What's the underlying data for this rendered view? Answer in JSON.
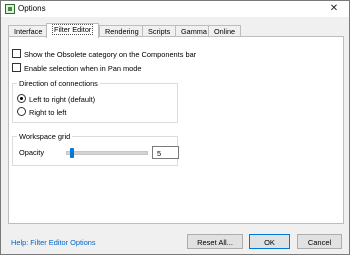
{
  "window": {
    "title": "Options",
    "close_glyph": "✕"
  },
  "tabs": [
    {
      "label": "Interface"
    },
    {
      "label": "Filter Editor"
    },
    {
      "label": "Rendering"
    },
    {
      "label": "Scripts"
    },
    {
      "label": "Gamma"
    },
    {
      "label": "Online"
    }
  ],
  "active_tab": "Filter Editor",
  "filter_editor": {
    "show_obsolete": {
      "label": "Show the Obsolete category on the Components bar",
      "checked": false
    },
    "enable_selection_pan": {
      "label": "Enable selection when in Pan mode",
      "checked": false
    },
    "direction_group": {
      "title": "Direction of connections",
      "options": [
        {
          "label": "Left to right (default)",
          "selected": true
        },
        {
          "label": "Right to left",
          "selected": false
        }
      ]
    },
    "workspace_grid": {
      "title": "Workspace grid",
      "opacity_label": "Opacity",
      "opacity_value": "5",
      "slider_min": 0,
      "slider_max": 100
    }
  },
  "footer": {
    "help_link": "Help: Filter Editor Options",
    "reset_label": "Reset All...",
    "ok_label": "OK",
    "cancel_label": "Cancel"
  },
  "colors": {
    "accent": "#0078d7",
    "link": "#0066cc"
  }
}
